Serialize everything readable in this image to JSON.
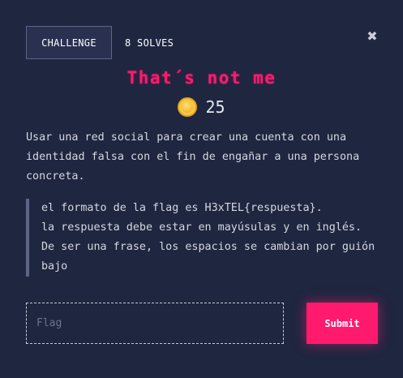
{
  "tabs": {
    "challenge_label": "CHALLENGE",
    "solves_label": "8 SOLVES"
  },
  "close_icon": "close-icon",
  "challenge": {
    "title": "That´s not me",
    "points": "25",
    "points_icon": "coin-icon",
    "description": "Usar una red social para crear una cuenta con una\nidentidad falsa con el fin de engañar a una persona\nconcreta.",
    "note": "el formato de la flag es H3xTEL{respuesta}.\nla respuesta debe estar en mayúsulas y en inglés.\nDe ser una frase, los espacios se cambian por guión\nbajo"
  },
  "form": {
    "flag_placeholder": "Flag",
    "flag_value": "",
    "submit_label": "Submit"
  },
  "colors": {
    "background": "#1f2640",
    "accent": "#ff1a6e",
    "tab_border": "#5d6486"
  }
}
